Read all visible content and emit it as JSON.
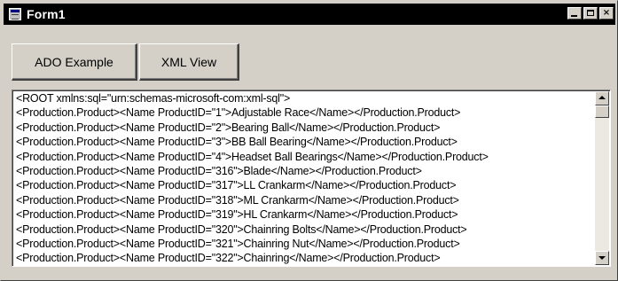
{
  "window": {
    "title": "Form1",
    "icon": "form-icon",
    "controls": {
      "minimize": "minimize",
      "maximize": "maximize",
      "close": "×"
    }
  },
  "buttons": {
    "ado_label": "ADO Example",
    "xml_label": "XML View"
  },
  "output": {
    "lines": [
      "<ROOT xmlns:sql=\"urn:schemas-microsoft-com:xml-sql\">",
      "<Production.Product><Name ProductID=\"1\">Adjustable Race</Name></Production.Product>",
      "<Production.Product><Name ProductID=\"2\">Bearing Ball</Name></Production.Product>",
      "<Production.Product><Name ProductID=\"3\">BB Ball Bearing</Name></Production.Product>",
      "<Production.Product><Name ProductID=\"4\">Headset Ball Bearings</Name></Production.Product>",
      "<Production.Product><Name ProductID=\"316\">Blade</Name></Production.Product>",
      "<Production.Product><Name ProductID=\"317\">LL Crankarm</Name></Production.Product>",
      "<Production.Product><Name ProductID=\"318\">ML Crankarm</Name></Production.Product>",
      "<Production.Product><Name ProductID=\"319\">HL Crankarm</Name></Production.Product>",
      "<Production.Product><Name ProductID=\"320\">Chainring Bolts</Name></Production.Product>",
      "<Production.Product><Name ProductID=\"321\">Chainring Nut</Name></Production.Product>",
      "<Production.Product><Name ProductID=\"322\">Chainring</Name></Production.Product>"
    ]
  },
  "colors": {
    "titlebar": "#000000",
    "face": "#d4d0c8",
    "text_bg": "#ffffff"
  }
}
